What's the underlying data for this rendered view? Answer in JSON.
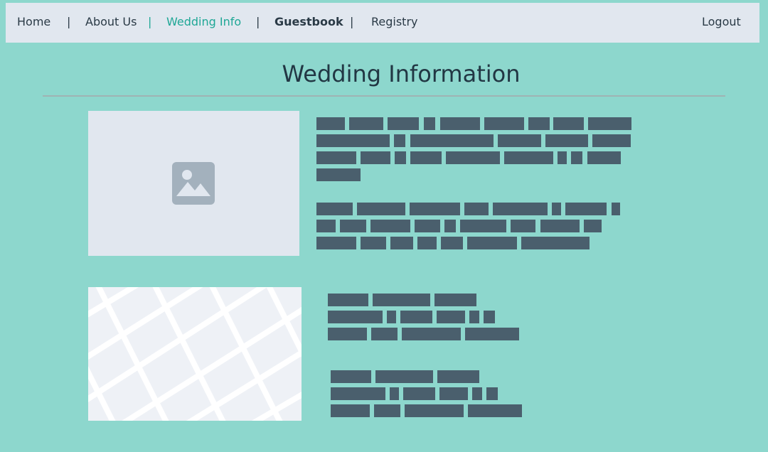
{
  "nav": {
    "home": "Home",
    "about": "About Us",
    "wedding_info": "Wedding Info",
    "guestbook": "Guestbook",
    "registry": "Registry",
    "logout": "Logout",
    "separator": "|"
  },
  "page": {
    "title": "Wedding Information"
  },
  "icons": {
    "image_placeholder": "image-icon",
    "map_placeholder": "map-icon"
  },
  "colors": {
    "background": "#8dd7cd",
    "nav_background": "#e1e7ef",
    "accent": "#1fa796",
    "text": "#2a3a46",
    "redacted_text": "#4a5f6d"
  }
}
